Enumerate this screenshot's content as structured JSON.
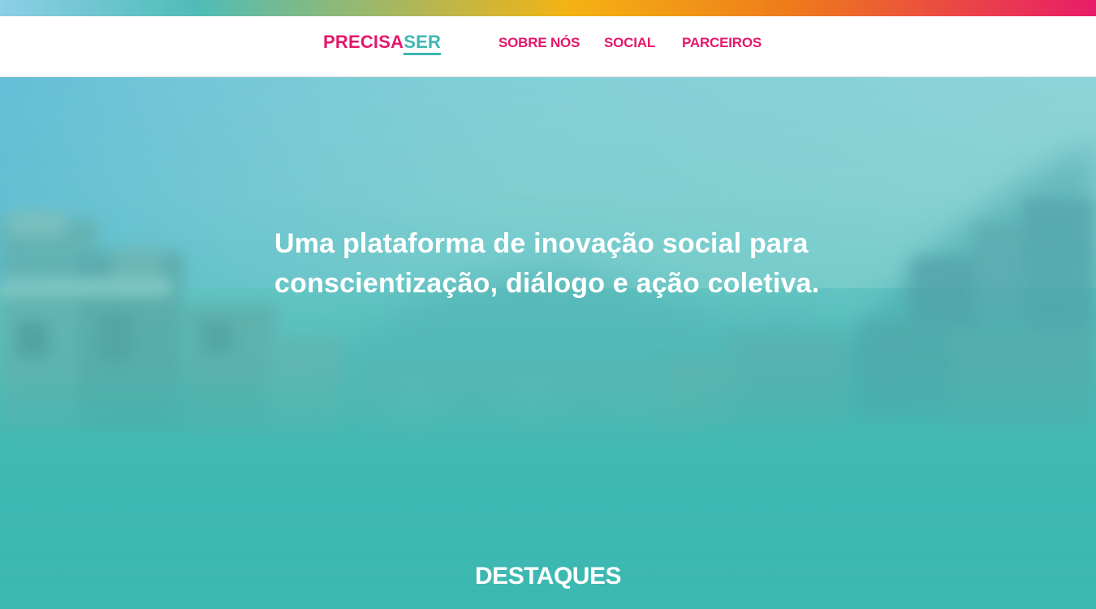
{
  "colors": {
    "brand_pink": "#e5176b",
    "brand_teal": "#3db8b1",
    "hero_text": "#ffffff",
    "navbar_bg": "#ffffff"
  },
  "header": {
    "logo": {
      "part1": "PRECISA",
      "part2": "SER"
    },
    "nav": [
      {
        "label": "SOBRE NÓS"
      },
      {
        "label": "SOCIAL"
      },
      {
        "label": "PARCEIROS"
      }
    ]
  },
  "hero": {
    "background": "blurred photo of a hillside community",
    "headline": "Uma plataforma de inovação social para conscientização, diálogo e ação coletiva."
  },
  "highlights": {
    "title": "DESTAQUES"
  }
}
